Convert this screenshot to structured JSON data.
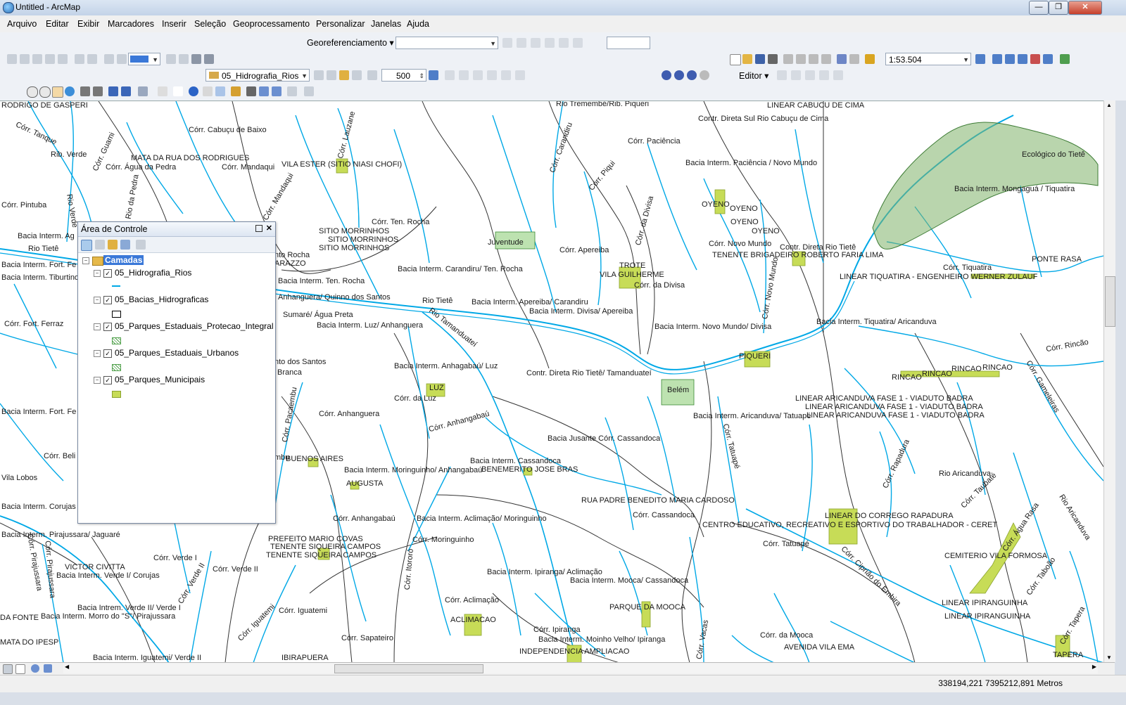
{
  "window": {
    "title": "Untitled - ArcMap",
    "min_label": "—",
    "max_label": "❐",
    "close_label": "✕"
  },
  "menu": [
    "Arquivo",
    "Editar",
    "Exibir",
    "Marcadores",
    "Inserir",
    "Seleção",
    "Geoprocessamento",
    "Personalizar",
    "Janelas",
    "Ajuda"
  ],
  "toolbar": {
    "georef_label": "Georeferenciamento",
    "layer_combo": "05_Hidrografia_Rios",
    "scale_value": "500",
    "map_scale": "1:53.504",
    "editor_label": "Editor"
  },
  "toc": {
    "title": "Área de Controle",
    "group_label": "Camadas",
    "layers": [
      {
        "name": "05_Hidrografia_Rios",
        "symbol": "line",
        "color": "#00a8e6"
      },
      {
        "name": "05_Bacias_Hidrograficas",
        "symbol": "hollow",
        "color": "#000000"
      },
      {
        "name": "05_Parques_Estaduais_Protecao_Integral",
        "symbol": "hatched",
        "color": "#4fa04a"
      },
      {
        "name": "05_Parques_Estaduais_Urbanos",
        "symbol": "hatched",
        "color": "#4fa04a"
      },
      {
        "name": "05_Parques_Municipais",
        "symbol": "fill",
        "color": "#c7dc57"
      }
    ]
  },
  "status": {
    "coords": "338194,221  7395212,891 Metros"
  },
  "map": {
    "labels": [
      "RODRIGO DE GASPERI",
      "Córr. Tanque",
      "Rib. Verde",
      "Córr. Guami",
      "Córr. Cabuçu de Baixo",
      "MATA DA RUA DOS RODRIGUES",
      "Córr. Água da Pedra",
      "Córr. Mandaqui",
      "VILA ESTER (SITIO NIASI CHOFI)",
      "Córr. Lauzane",
      "Rio Tremembé/Rib. Piqueri",
      "LINEAR CABUCU DE CIMA",
      "Contr. Direta Sul Rio Cabuçu de Cima",
      "Córr. Paciência",
      "Córr. Carandiru",
      "Córr. Piqui",
      "Bacia Interm. Paciência / Novo Mundo",
      "Ecológico do Tietê",
      "Bacia Interm. Mongaguá / Tiquatira",
      "Córr. Pintuba",
      "Rio Verde",
      "Rio da Pedra",
      "Córr. Mandaqui",
      "OYENO",
      "OYENO",
      "OYENO",
      "OYENO",
      "Córr. Ten. Rocha",
      "SITIO MORRINHOS",
      "SITIO MORRINHOS",
      "SITIO MORRINHOS",
      "Juventude",
      "Córr. Apereiba",
      "Córr. da Divisa",
      "Córr. Novo Mundo",
      "Contr. Direta Rio Tietê",
      "TENENTE BRIGADEIRO ROBERTO FARIA LIMA",
      "Córr. Tiquatira",
      "PONTE RASA",
      "Bacia Interm. Carandiru/ Ten. Rocha",
      "TROTE",
      "VILA GUILHERME",
      "Córr. da Divisa",
      "LINEAR TIQUATIRA - ENGENHEIRO WERNER ZULAUF",
      "Bacia Interm. Ten. Rocha",
      "Anhanguera/ Quinno dos Santos",
      "Rio Tietê",
      "Bacia Interm. Apereiba/ Carandiru",
      "Bacia Interm. Divisa/ Apereiba",
      "Córr. Novo Mundo",
      "Sumaré/ Água Preta",
      "Bacia Interm. Luz/ Anhanguera",
      "Rio Tamanduateí",
      "Bacia Interm. Novo Mundo/ Divisa",
      "Bacia Interm. Tiquatira/ Aricanduva",
      "Córr. Rincão",
      "PIQUERI",
      "Bacia Interm. Anhagabaú/ Luz",
      "Contr. Direta Rio Tietê/ Tamanduateí",
      "RINCAO",
      "RINCAO",
      "RINCAO",
      "RINCAO",
      "Córr. Gameleiras",
      "LUZ",
      "Córr. da Luz",
      "Belém",
      "LINEAR ARICANDUVA FASE 1 - VIADUTO BADRA",
      "LINEAR ARICANDUVA FASE 1 - VIADUTO BADRA",
      "LINEAR ARICANDUVA FASE 1 - VIADUTO BADRA",
      "Córr. Anhanguera",
      "Bacia Interm. Aricanduva/ Tatuapé",
      "Córr. Anhangabaú",
      "Córr. Tatuapé",
      "Bacia Jusante Córr. Cassandoca",
      "Córr. Rapadura",
      "BUENOS AIRES",
      "Bacia Interm. Cassandoca",
      "BENEMERITO JOSE BRAS",
      "Rio Aricanduva",
      "Bacia Interm. Moringuinho/ Anhangabaú",
      "AUGUSTA",
      "Córr. Taubaté",
      "RUA PADRE BENEDITO MARIA CARDOSO",
      "Rio Aricanduva",
      "Córr. Anhangabaú",
      "Bacia Interm. Aclimação/ Moringuinho",
      "Córr. Cassandoca",
      "LINEAR DO CORREGO RAPADURA",
      "CENTRO EDUCATIVO, RECREATIVO E ESPORTIVO DO TRABALHADOR - CERET",
      "Córr. Água Rasa",
      "PREFEITO MARIO COVAS",
      "TENENTE SIQUEIRA CAMPOS",
      "TENENTE SIQUEIRA CAMPOS",
      "Córr. Moringuinho",
      "Córr. Tatuapé",
      "CEMITERIO VILA FORMOSA",
      "VICTOR CIVITTA",
      "Bacia Interm. Verde I/ Corujas",
      "Córr. Verde I",
      "Córr. Verde II",
      "Córr. Verde II",
      "Córr. Itororó",
      "Bacia Interm. Ipiranga/ Aclimação",
      "Bacia Interm. Mooca/ Cassandoca",
      "Córr. Ciprião do Embira",
      "Córr. Taboão",
      "Córr. Pirajussara",
      "Bacia Intrem. Verde II/ Verde I",
      "Córr. Aclimação",
      "PARQUE DA MOOCA",
      "LINEAR IPIRANGUINHA",
      "DA FONTE",
      "Bacia Interm. Morro do \"S\"/ Pirajussara",
      "Córr. Iguatemi",
      "ACLIMACAO",
      "LINEAR IPIRANGUINHA",
      "Córr. Iguatemi",
      "Córr. Ipiranga",
      "MATA DO IPESP",
      "Córr. Sapateiro",
      "Bacia Interm. Moinho Velho/ Ipiranga",
      "Córr. Vacas",
      "Córr. da Mooca",
      "AVENIDA VILA EMA",
      "Córr. Tapera",
      "Bacia Interm. Iguatemi/ Verde II",
      "IBIRAPUERA",
      "INDEPENDENCIA AMPLIACAO",
      "TAPERA",
      "Córr. Pirajussara",
      "Bacia Interm. Pirajussara/ Jaguaré",
      "Vila Lobos",
      "Córr. Beli",
      "Bacia Interm. Fort. Fe",
      "Córr. Fort. Ferraz",
      "Bacia Interm. Tiburtino",
      "Bacia Interm. Fort. Fe",
      "Bacia Interm. Corujas",
      "Bacia Interm. Ag",
      "Rio Tietê",
      "Córr. Pacaembu",
      "Branca",
      "nto Rocha",
      "ARAZZO",
      "nto dos Santos",
      "mbu"
    ]
  }
}
